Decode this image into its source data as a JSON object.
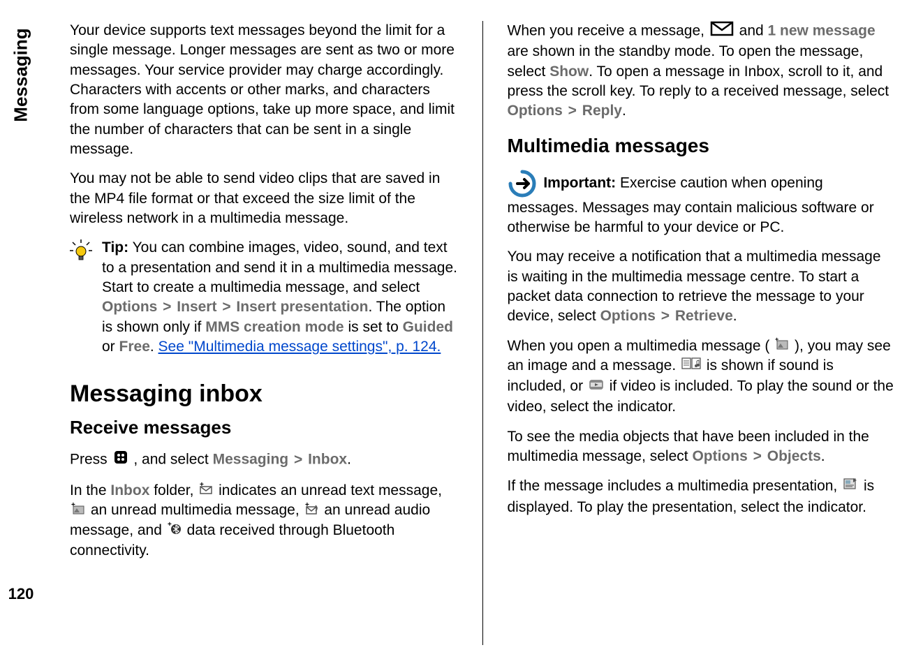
{
  "side": {
    "section_label": "Messaging",
    "page_number": "120"
  },
  "left": {
    "p1": "Your device supports text messages beyond the limit for a single message. Longer messages are sent as two or more messages. Your service provider may charge accordingly. Characters with accents or other marks, and characters from some language options, take up more space, and limit the number of characters that can be sent in a single message.",
    "p2": "You may not be able to send video clips that are saved in the MP4 file format or that exceed the size limit of the wireless network in a multimedia message.",
    "tip_label": "Tip:",
    "tip_a": "  You can combine images, video, sound, and text to a presentation and send it in a multimedia message. Start to create a multimedia message, and select ",
    "options": "Options",
    "insert": "Insert",
    "insert_presentation": "Insert presentation",
    "tip_b": ". The option is shown only if ",
    "mms_mode": "MMS creation mode",
    "tip_c": " is set to ",
    "guided": "Guided",
    "tip_d": " or ",
    "free": "Free",
    "tip_e": ". ",
    "tip_link": "See \"Multimedia message settings\", p. 124.",
    "h2": "Messaging inbox",
    "h3": "Receive messages",
    "recv_a": "Press ",
    "recv_b": " , and select ",
    "messaging": "Messaging",
    "inbox": "Inbox",
    "recv_c": ".",
    "inbox_a": "In the ",
    "inbox_b": " folder, ",
    "inbox_c": " indicates an unread text message, ",
    "inbox_d": " an unread multimedia message, ",
    "inbox_e": " an unread audio message, and ",
    "inbox_f": " data received through Bluetooth connectivity."
  },
  "right": {
    "p1_a": "When you receive a message, ",
    "p1_b": " and ",
    "one_new_message": "1 new message",
    "p1_c": " are shown in the standby mode. To open the message, select ",
    "show": "Show",
    "p1_d": ". To open a message in Inbox, scroll to it, and press the scroll key. To reply to a received message, select ",
    "options": "Options",
    "reply": "Reply",
    "p1_e": ".",
    "h3": "Multimedia messages",
    "important_label": "Important:",
    "important_text": " Exercise caution when opening messages. Messages may contain malicious software or otherwise be harmful to your device or PC.",
    "p2_a": "You may receive a notification that a multimedia message is waiting in the multimedia message centre. To start a packet data connection to retrieve the message to your device, select ",
    "retrieve": "Retrieve",
    "p2_b": ".",
    "p3_a": "When you open a multimedia message (",
    "p3_b": "), you may see an image and a message. ",
    "p3_c": " is shown if sound is included, or ",
    "p3_d": " if video is included. To play the sound or the video, select the indicator.",
    "p4_a": "To see the media objects that have been included in the multimedia message, select ",
    "objects": "Objects",
    "p4_b": ".",
    "p5_a": "If the message includes a multimedia presentation, ",
    "p5_b": " is displayed. To play the presentation, select the indicator."
  },
  "ui": {
    "gt": ">"
  }
}
